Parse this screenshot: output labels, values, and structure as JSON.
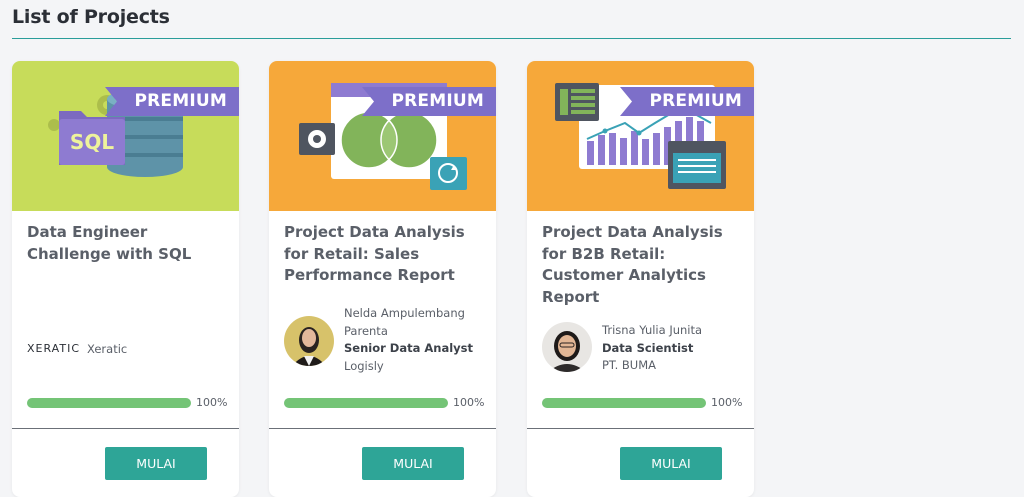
{
  "page": {
    "title": "List of Projects"
  },
  "theme": {
    "accent": "#2ea597",
    "progress": "#74c476",
    "premium_ribbon": "#7d6fc9"
  },
  "projects": [
    {
      "title": "Data Engineer Challenge with SQL",
      "badge": "PREMIUM",
      "banner_color": "#c7dc5a",
      "banner_icon": "sql-database-icon",
      "banner_text": "SQL",
      "organizer_logo": "XERATIC",
      "organizer_name": "Xeratic",
      "progress_percent": 100,
      "progress_label": "100%",
      "button_label": "MULAI"
    },
    {
      "title": "Project Data Analysis for Retail: Sales Performance Report",
      "badge": "PREMIUM",
      "banner_color": "#f6a83a",
      "banner_icon": "venn-diagram-icon",
      "author_name": "Nelda Ampulembang Parenta",
      "author_role": "Senior Data Analyst",
      "author_company": "Logisly",
      "progress_percent": 100,
      "progress_label": "100%",
      "button_label": "MULAI"
    },
    {
      "title": "Project Data Analysis for B2B Retail: Customer Analytics Report",
      "badge": "PREMIUM",
      "banner_color": "#f6a83a",
      "banner_icon": "bar-line-chart-icon",
      "author_name": "Trisna Yulia Junita",
      "author_role": "Data Scientist",
      "author_company": "PT. BUMA",
      "progress_percent": 100,
      "progress_label": "100%",
      "button_label": "MULAI"
    }
  ]
}
